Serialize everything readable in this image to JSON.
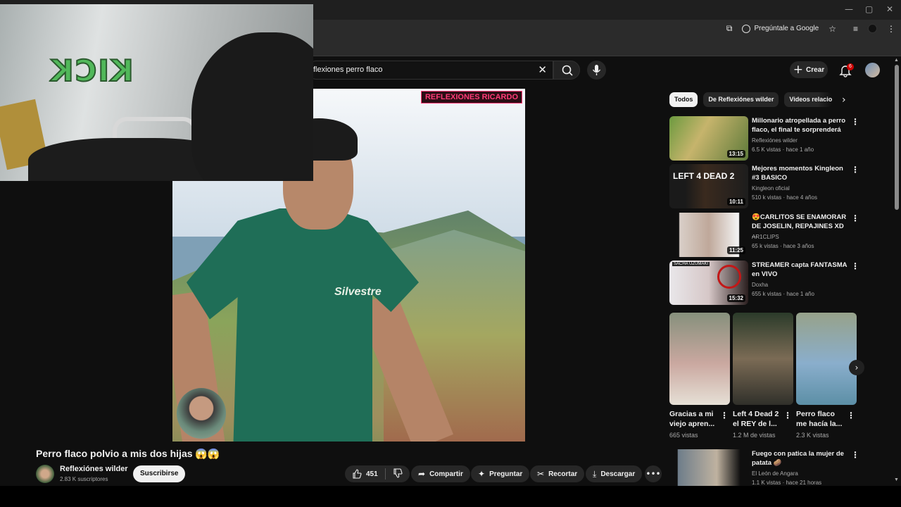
{
  "browser": {
    "window_controls": [
      "—",
      "▢",
      "✕"
    ],
    "ask_google_label": "Pregúntale a Google",
    "bookmark_icon": "star-icon"
  },
  "youtube": {
    "search_query": "flexiones perro flaco",
    "create_label": "Crear",
    "notification_count": "6"
  },
  "video": {
    "watermark": "REFLEXIONES RICARDO",
    "shirt_logo": "Silvestre",
    "title": "Perro flaco polvio a mis dos hijas 😱😱",
    "channel": "Reflexiónes wilder",
    "subscribers": "2.83 K suscriptores",
    "subscribe_label": "Suscribirse",
    "likes": "451",
    "actions": {
      "share": "Compartir",
      "ask": "Preguntar",
      "clip": "Recortar",
      "download": "Descargar"
    }
  },
  "webcam": {
    "wall_text": "KICK"
  },
  "sidebar": {
    "chips": [
      "Todos",
      "De Reflexiónes wilder",
      "Videos relacion"
    ],
    "recommendations": [
      {
        "title": "Millonario atropellada a perro flaco, el final te sorprenderá",
        "channel": "Reflexiónes wilder",
        "meta": "6.5 K vistas · hace 1 año",
        "duration": "13:15"
      },
      {
        "title": "Mejores momentos Kingleon #3 BASICO",
        "channel": "Kingleon oficial",
        "meta": "510 k vistas · hace 4 años",
        "duration": "10:11"
      },
      {
        "title": "😍CARLITOS SE ENAMORAR DE JOSELIN, REPAJINES XD ...",
        "channel": "AR1CLIPS",
        "meta": "65 k vistas · hace 3 años",
        "duration": "11:25"
      },
      {
        "title": "STREAMER capta FANTASMA en VIVO",
        "channel": "Doxha",
        "meta": "655 k vistas · hace 1 año",
        "duration": "15:32"
      }
    ],
    "shorts": [
      {
        "title": "Gracias a mi viejo apren...",
        "views": "665 vistas"
      },
      {
        "title": "Left 4 Dead 2 el REY de l...",
        "views": "1.2 M de vistas"
      },
      {
        "title": "Perro flaco me hacía la...",
        "views": "2.3 K vistas"
      }
    ],
    "last_rec": {
      "title": "Fuego con patica la mujer de patata 🥔",
      "channel": "El León de Angara",
      "meta": "1.1 K vistas · hace 21 horas"
    }
  },
  "thumb_texts": {
    "kingleon": "LEFT 4 DEAD 2",
    "streamer": "SACHA UZUMAKI"
  }
}
